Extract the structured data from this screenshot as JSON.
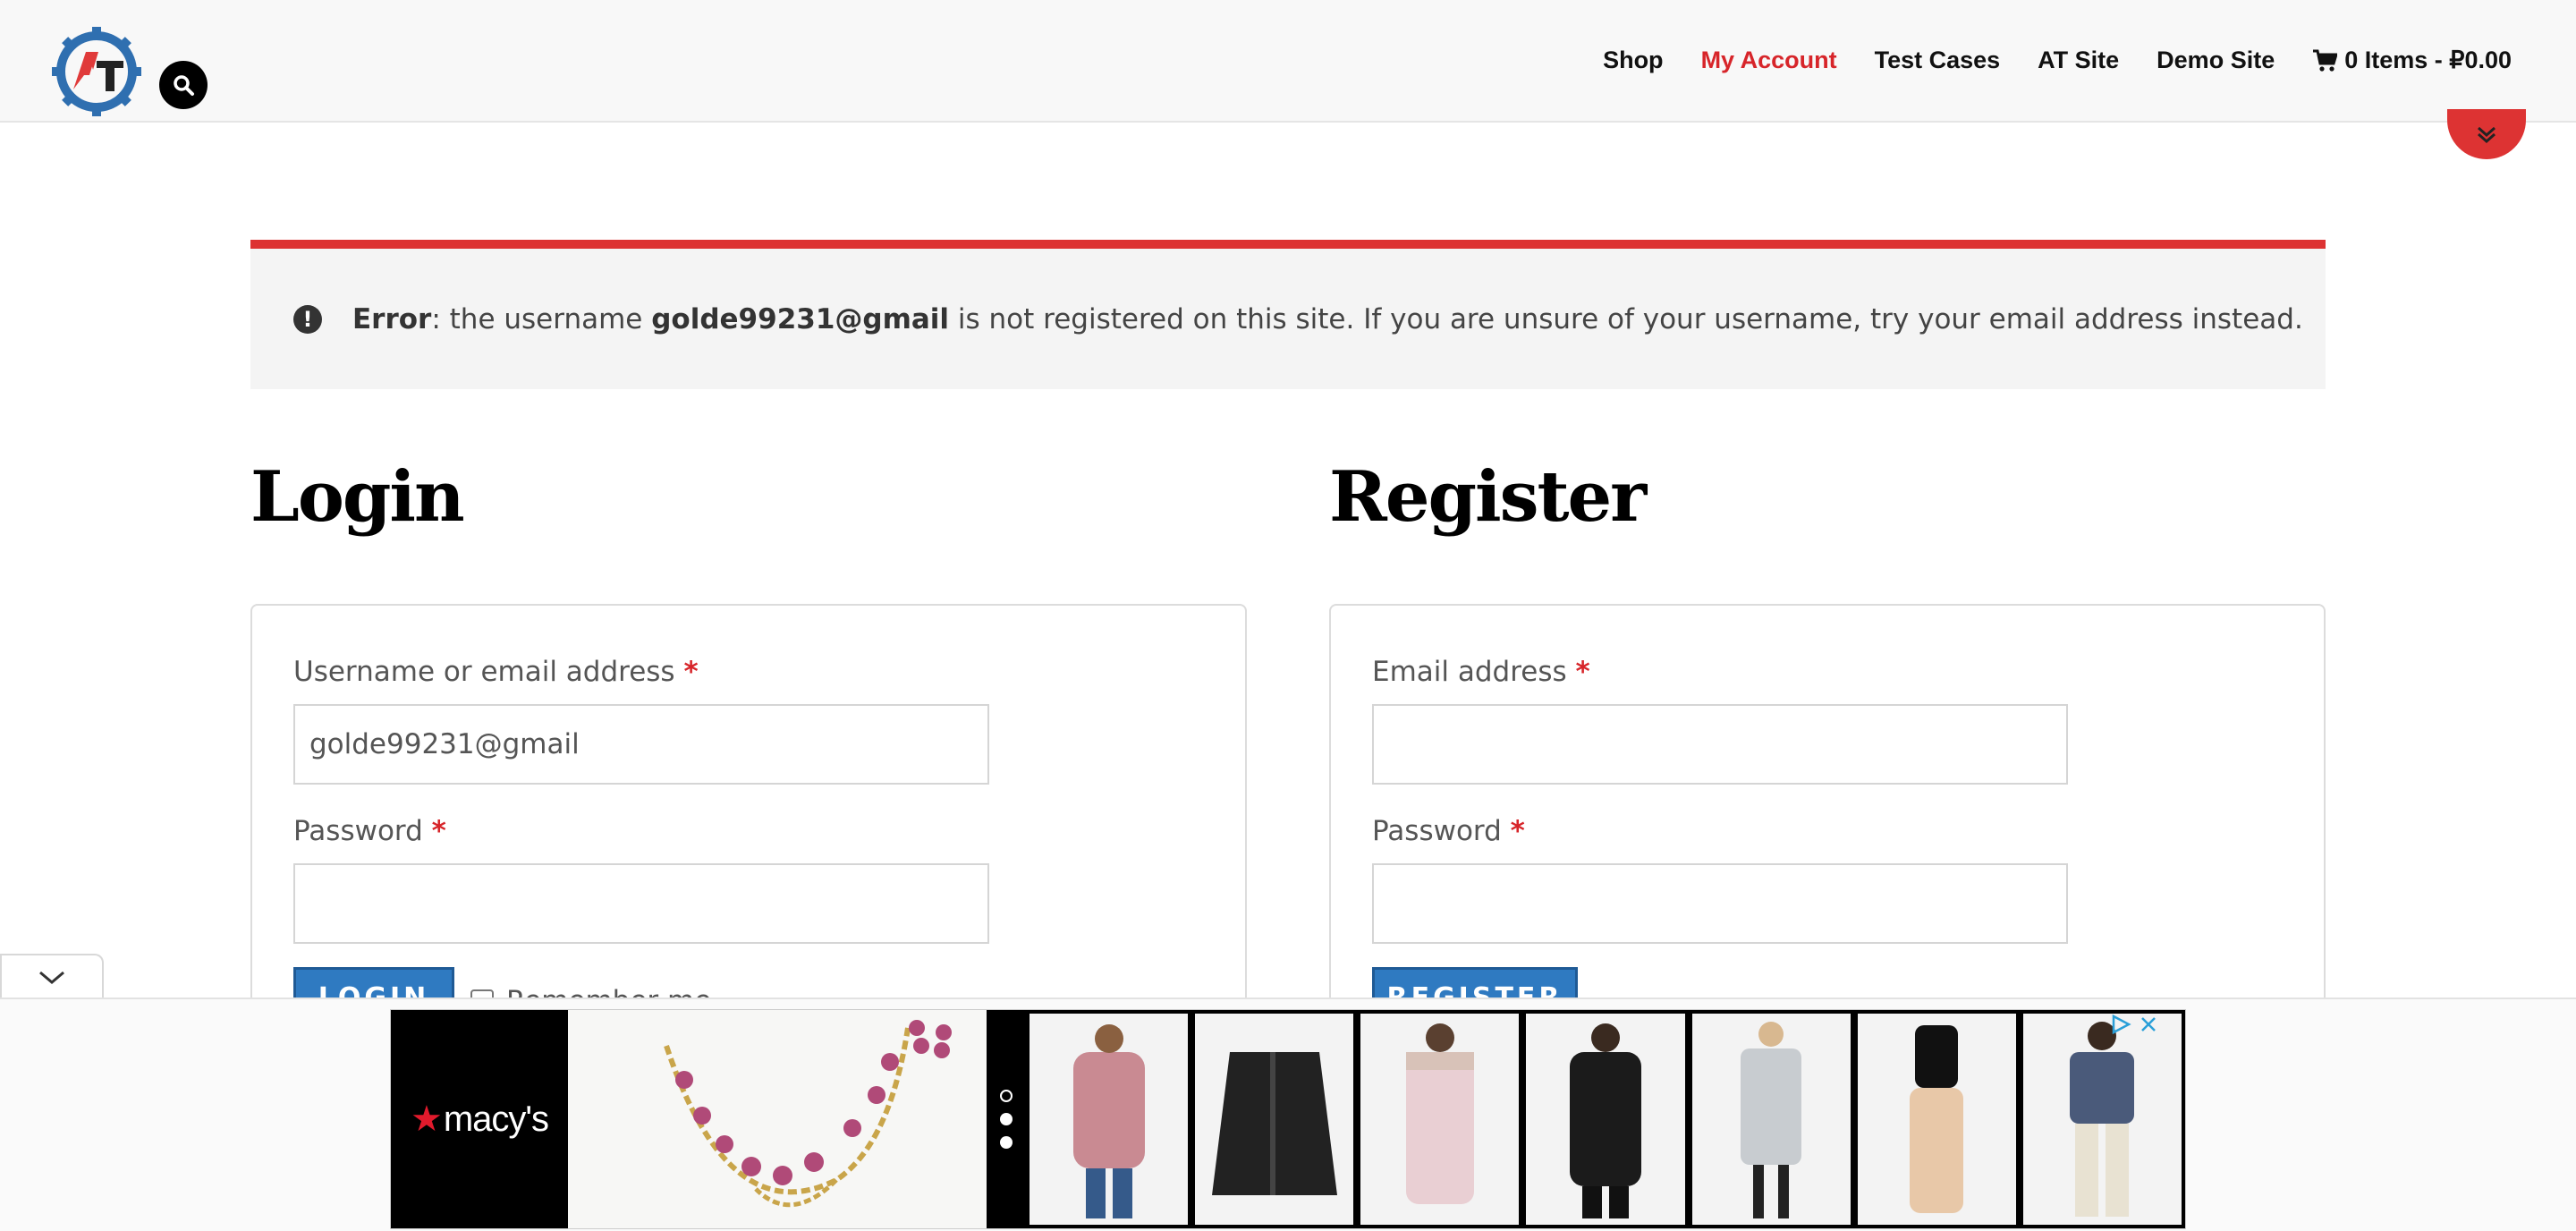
{
  "header": {
    "nav": [
      {
        "label": "Shop",
        "active": false
      },
      {
        "label": "My Account",
        "active": true
      },
      {
        "label": "Test Cases",
        "active": false
      },
      {
        "label": "AT Site",
        "active": false
      },
      {
        "label": "Demo Site",
        "active": false
      }
    ],
    "cart_label": "0 Items - ₽0.00"
  },
  "notice": {
    "prefix": "Error",
    "text_before": ": the username ",
    "username": "golde99231@gmail",
    "text_after": " is not registered on this site. If you are unsure of your username, try your email address instead."
  },
  "login": {
    "title": "Login",
    "username_label": "Username or email address",
    "username_value": "golde99231@gmail",
    "password_label": "Password",
    "required_mark": "*",
    "button_label": "LOGIN",
    "remember_label": "Remember me"
  },
  "register": {
    "title": "Register",
    "email_label": "Email address",
    "password_label": "Password",
    "required_mark": "*",
    "button_label": "REGISTER"
  },
  "ad": {
    "brand": "macy's",
    "brand_star": "★"
  },
  "colors": {
    "accent_red": "#dd3333",
    "button_blue": "#2f7ac1"
  }
}
